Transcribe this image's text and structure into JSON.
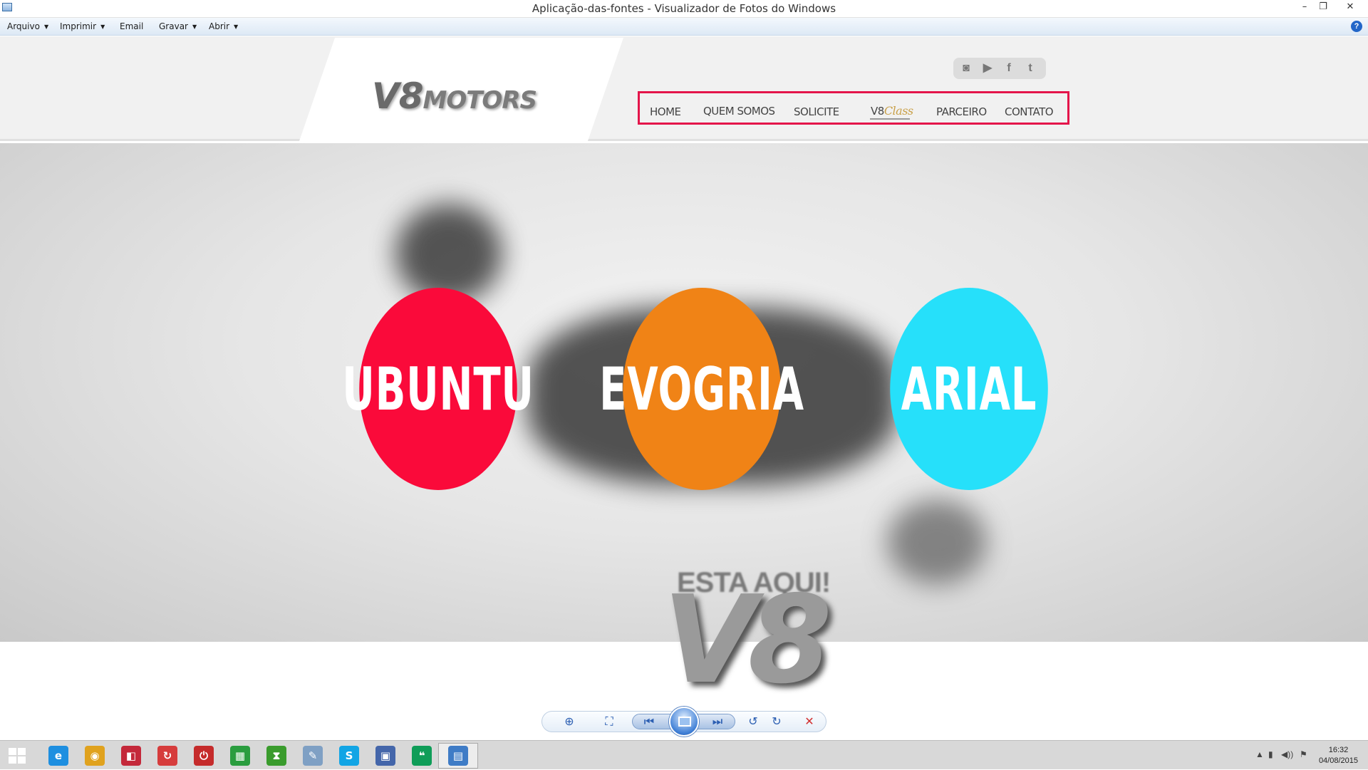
{
  "window": {
    "title": "Aplicação-das-fontes - Visualizador de Fotos do Windows",
    "minimize_glyph": "–",
    "restore_glyph": "❐",
    "close_glyph": "✕"
  },
  "menubar": {
    "items": [
      "Arquivo",
      "Imprimir",
      "Email",
      "Gravar",
      "Abrir"
    ],
    "help_glyph": "?"
  },
  "site": {
    "logo_v8": "V8",
    "logo_motors": "MOTORS",
    "nav": [
      "HOME",
      "QUEM SOMOS",
      "SOLICITE",
      "V8",
      "PARCEIRO",
      "CONTATO"
    ],
    "nav_class_word": "Class",
    "social_icons": [
      "instagram-icon",
      "youtube-icon",
      "facebook-icon",
      "twitter-icon"
    ],
    "social_glyphs": [
      "◙",
      "▶",
      "f",
      "t"
    ],
    "hero_text": "ESTA AQUI!",
    "big_logo": "V8",
    "highlight_color": "#e4154a"
  },
  "fonts_circles": [
    {
      "label": "UBUNTU",
      "color": "#fa0a3a"
    },
    {
      "label": "EVOGRIA",
      "color": "#f08316"
    },
    {
      "label": "ARIAL",
      "color": "#26e0fa"
    }
  ],
  "viewer_toolbar": {
    "zoom_glyph": "⊕",
    "fit_glyph": "⛶",
    "prev_glyph": "⏮",
    "next_glyph": "⏭",
    "rotate_left_glyph": "↺",
    "rotate_right_glyph": "↻",
    "delete_glyph": "✕"
  },
  "taskbar": {
    "apps": [
      {
        "name": "internet-explorer-icon",
        "glyph": "e",
        "color": "#1e8fe0"
      },
      {
        "name": "chrome-icon",
        "glyph": "◉",
        "color": "#e0a21e"
      },
      {
        "name": "app-red-toggle-icon",
        "glyph": "◧",
        "color": "#c4283a"
      },
      {
        "name": "sync-app-icon",
        "glyph": "↻",
        "color": "#d63c3c"
      },
      {
        "name": "power-app-icon",
        "glyph": "⏻",
        "color": "#c52b2b"
      },
      {
        "name": "store-icon",
        "glyph": "▦",
        "color": "#2a9d3f"
      },
      {
        "name": "corel-icon",
        "glyph": "⧗",
        "color": "#3a9c2d"
      },
      {
        "name": "notepad-icon",
        "glyph": "✎",
        "color": "#7fa0c4"
      },
      {
        "name": "skype-icon",
        "glyph": "S",
        "color": "#12a5e5"
      },
      {
        "name": "network-app-icon",
        "glyph": "▣",
        "color": "#4466aa"
      },
      {
        "name": "hangouts-icon",
        "glyph": "❝",
        "color": "#0f9d58"
      },
      {
        "name": "photo-viewer-icon",
        "glyph": "▤",
        "color": "#3f7cc6"
      }
    ],
    "tray_glyphs": [
      "▲",
      "▮",
      "◀))",
      "⚑"
    ],
    "time": "16:32",
    "date": "04/08/2015"
  }
}
